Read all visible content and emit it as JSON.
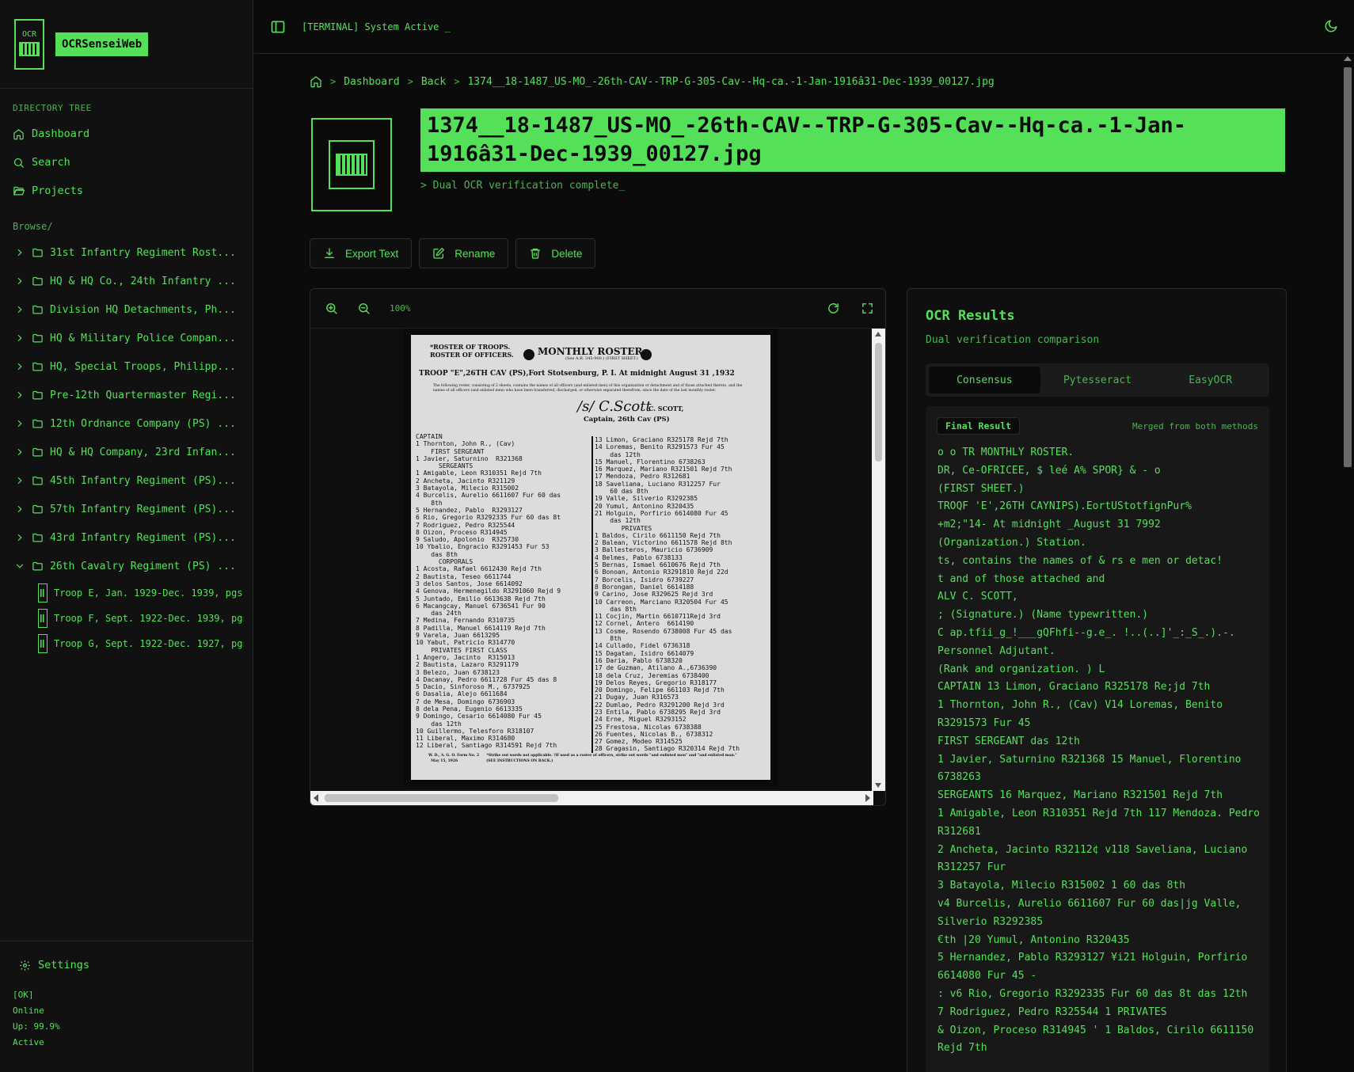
{
  "brand": {
    "logo_text": "OCR",
    "name": "OCRSenseiWeb"
  },
  "sidebar": {
    "directory_title": "DIRECTORY TREE",
    "nav": [
      {
        "label": "Dashboard",
        "icon": "home-icon"
      },
      {
        "label": "Search",
        "icon": "search-icon"
      },
      {
        "label": "Projects",
        "icon": "folder-open-icon"
      }
    ],
    "browse_title": "Browse/",
    "folders": [
      "31st Infantry Regiment Rost...",
      "HQ & HQ Co., 24th Infantry ...",
      "Division HQ Detachments, Ph...",
      "HQ & Military Police Compan...",
      "HQ, Special Troops, Philipp...",
      "Pre-12th Quartermaster Regi...",
      "12th Ordnance Company (PS) ...",
      "HQ & HQ Company, 23rd Infan...",
      "45th Infantry Regiment (PS)...",
      "57th Infantry Regiment (PS)...",
      "43rd Infantry Regiment (PS)...",
      "26th Cavalry Regiment (PS) ..."
    ],
    "files": [
      "Troop E, Jan. 1929-Dec. 1939, pgs",
      "Troop F, Sept. 1922-Dec. 1939, pgs",
      "Troop G, Sept. 1922-Dec. 1927, pgs"
    ],
    "settings_label": "Settings",
    "status": {
      "ok": "[OK]",
      "online": "Online",
      "uptime": "Up: 99.9%",
      "state": "Active"
    }
  },
  "topbar": {
    "terminal": "[TERMINAL] System Active _"
  },
  "breadcrumb": {
    "dashboard": "Dashboard",
    "back": "Back",
    "current": "1374__18-1487_US-MO_-26th-CAV--TRP-G-305-Cav--Hq-ca.-1-Jan-1916â31-Dec-1939_00127.jpg"
  },
  "file": {
    "title": "1374__18-1487_US-MO_-26th-CAV--TRP-G-305-Cav--Hq-ca.-1-Jan-1916â31-Dec-1939_00127.jpg",
    "subtitle": "> Dual OCR verification complete_"
  },
  "actions": {
    "export": "Export Text",
    "rename": "Rename",
    "delete": "Delete"
  },
  "viewer": {
    "zoom": "100%"
  },
  "document": {
    "hdr_left": "*ROSTER OF TROOPS.\nROSTER OF OFFICERS.",
    "title": "MONTHLY ROSTER.",
    "sub": "(See A.R. 345-900.)  (FIRST SHEET.)",
    "line1": "TROOP \"E\",26TH CAV (PS),Fort Stotsenburg, P. I.  At midnight August 31 ,1932",
    "fine": "The following roster, consisting of 2 sheets, contains the names of all officers (and enlisted men) of this organization or detachment and of those attached thereto, and the names of all officers (and enlisted men) who have been transferred, discharged, or otherwise separated therefrom, since the date of the last monthly roster.",
    "sig": "/s/ C.Scott",
    "scott": "C. SCOTT,",
    "capt": "Captain, 26th Cav (PS)",
    "col_left": "CAPTAIN\n1 Thornton, John R., (Cav)\n    FIRST SERGEANT\n1 Javier, Saturnino  R321368\n      SERGEANTS\n1 Amigable, Leon R310351 Rejd 7th\n2 Ancheta, Jacinto R321129\n3 Batayola, Milecio R315002\n4 Burcelis, Aurelio 6611607 Fur 60 das\n    8th\n5 Hernandez, Pablo  R3293127\n6 Rio, Gregorio R3292335 Fur 60 das 8t\n7 Rodriguez, Pedro R325544\n8 Oizon, Proceso R314945\n9 Saludo, Apolonio  R325730\n10 Ybalio, Engracio R3291453 Fur 53\n    das 8th\n      CORPORALS\n1 Acosta, Rafael 6612430 Rejd 7th\n2 Bautista, Teseo 6611744\n3 delos Santos, Jose 6614092\n4 Genova, Hermenegildo R3291060 Rejd 9\n5 Juntado, Emilio 6613638 Rejd 7th\n6 Macangcay, Manuel 6736541 Fur 90\n    das 24th\n7 Medina, Fernando R310735\n8 Padilla, Manuel 6614119 Rejd 7th\n9 Varela, Juan 6613295\n10 Yabut, Patricio R314770\n    PRIVATES FIRST CLASS\n1 Angero, Jacinto  R315013\n2 Bautista, Lazaro R3291179\n3 Belezo, Juan 6738123\n4 Dacanay, Pedro 6611728 Fur 45 das 8\n5 Dacio, Sinforoso M., 6737925\n6 Dasalia, Alejo 6611684\n7 de Mesa, Domingo 6736903\n8 dela Pena, Eugenio 6613335\n9 Domingo, Cesario 6614080 Fur 45\n    das 12th\n10 Guillermo, Telesforo R318107\n11 Liberal, Maximo R314680\n12 Liberal, Santiago R314591 Rejd 7th",
    "col_right": "13 Limon, Graciano R325178 Rejd 7th\n14 Loremas, Benito R3291573 Fur 45\n    das 12th\n15 Manuel, Florentino 6738263\n16 Marquez, Mariano R321501 Rejd 7th\n17 Mendoza, Pedro R312681\n18 Saveliana, Luciano R312257 Fur\n    60 das 8th\n19 Valle, Silverio R3292385\n20 Yumul, Antonino R320435\n21 Holguin, Porfirio 6614080 Fur 45\n    das 12th\n       PRIVATES\n1 Baldos, Cirilo 6611150 Rejd 7th\n2 Balean, Victorino 6611578 Rejd 8th\n3 Ballesteros, Mauricio 6736909\n4 Belmes, Pablo 6738133\n5 Bernas, Ismael 6610676 Rejd 7th\n6 Bonoan, Antonio R3291810 Rejd 22d\n7 Borcelis, Isidro 6739227\n8 Borongan, Daniel 6614188\n9 Carino, Jose R329625 Rejd 3rd\n10 Carreon, Marciano R320504 Fur 45\n    das 8th\n11 Cocjin, Martin 6610711Rejd 3rd\n12 Cornel, Antero  6614190\n13 Cosme, Rosendo 6738008 Fur 45 das\n    8th\n14 Cullado, Fidel 6736318\n15 Dagatan, Isidro 6614079\n16 Daria, Pablo 6738320\n17 de Guzman, Atilano A.,6736390\n18 dela Cruz, Jeremias 6738400\n19 Delos Reyes, Gregorio R318177\n20 Domingo, Felipe 661103 Rejd 7th\n21 Dugay, Juan R316573\n22 Dumlao, Pedro R3291200 Rejd 3rd\n23 Entila, Pablo 6738295 Rejd 3rd\n24 Erne, Miguel R3293152\n25 Frestosa, Nicolas 6738388\n26 Fuentes, Nicolas B., 6738312\n27 Gomez, Modeo R314525\n28 Gragasin, Santiago R320314 Rejd 7th",
    "foot": "W. D., A. G. O. Form No. 2      *Strike out words not applicable. †If used as a roster of officers, strike out words \"and enlisted men\" and \"and enlisted man.\"\n  May 15, 1926                       (SEE INSTRUCTIONS ON BACK.)"
  },
  "ocr": {
    "title": "OCR Results",
    "description": "Dual verification comparison",
    "tabs": [
      "Consensus",
      "Pytesseract",
      "EasyOCR"
    ],
    "badge": "Final Result",
    "merged": "Merged from both methods",
    "text": "o o TR MONTHLY ROSTER.\nDR, Ce-OFRICEE, $ leé A% SPOR} & - o\n(FIRST SHEET.)\nTROQF 'E',26TH CAYNIPS).EortUStotfignPur%\n+m2;\"14- At midnight _August 31 7992\n(Organization.) Station.\nts, contains the names of & rs e men or detac!\nt and of those attached and\nALV C. SCOTT,\n; (Signature.) (Name typewritten.)\nC ap.tfii_g_!___gQFhfi--g.e_. !..(..]'_:_S_.).-.\nPersonnel Adjutant.\n(Rank and organization. ) L\nCAPTAIN 13 Limon, Graciano R325178 Re;jd 7th\n1 Thornton, John R., (Cav) V14 Loremas, Benito R3291573 Fur 45\nFIRST SERGEANT das 12th\n1 Javier, Saturnino R321368 15 Manuel, Florentino 6738263\nSERGEANTS 16 Marquez, Mariano R321501 Rejd 7th\n1 Amigable, Leon R310351 Rejd 7th 117 Mendoza. Pedro R312681\n2 Ancheta, Jacinto R32112¢ v118 Saveliana, Luciano R312257 Fur\n3 Batayola, Milecio R315002 1 60 das 8th\nv4 Burcelis, Aurelio 6611607 Fur 60 das|jg Valle, Silverio R3292385\n€th |20 Yumul, Antonino R320435\n5 Hernandez, Pablo R3293127 ¥i21 Holguin, Porfirio 6614080 Fur 45 -\n: v6 Rio, Gregorio R3292335 Fur 60 das 8t das 12th\n7 Rodriguez, Pedro R325544 1 PRIVATES\n& Oizon, Proceso R314945 ' 1 Baldos, Cirilo 6611150 Rejd 7th"
  }
}
